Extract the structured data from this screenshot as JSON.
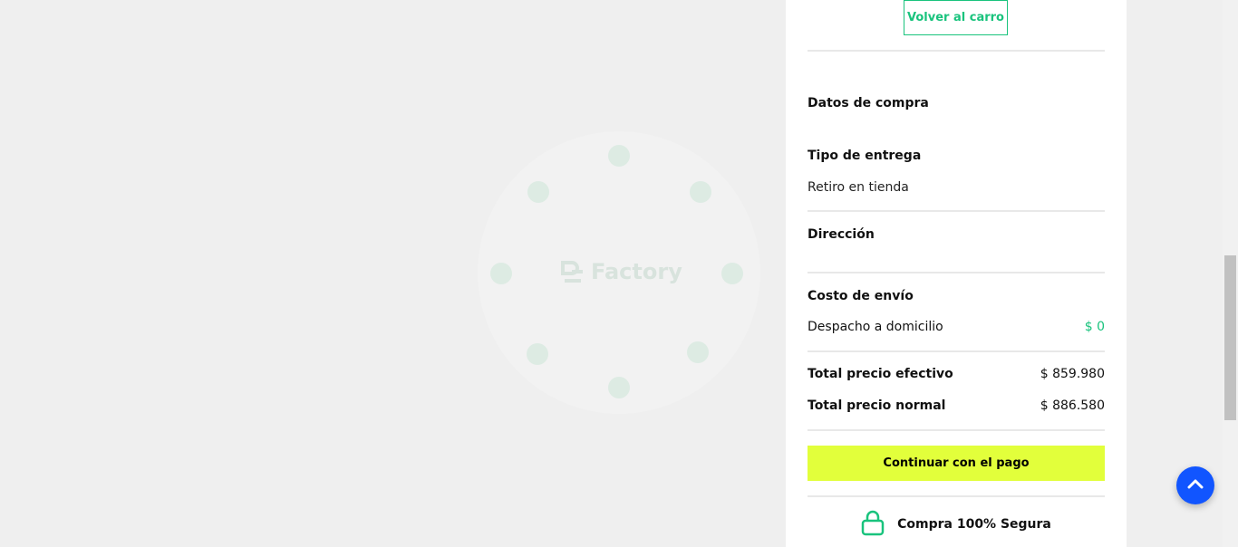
{
  "loader": {
    "logo_text": "Factory",
    "logo_icon": "factory-logo-icon"
  },
  "summary": {
    "back_button": "Volver al carro",
    "section_title": "Datos de compra",
    "delivery": {
      "heading": "Tipo de entrega",
      "value": "Retiro en tienda"
    },
    "address": {
      "heading": "Dirección"
    },
    "shipping": {
      "heading": "Costo de envío",
      "label": "Despacho a domicilio",
      "value": "$ 0"
    },
    "totals": {
      "cash_label": "Total precio efectivo",
      "cash_value": "$ 859.980",
      "normal_label": "Total precio normal",
      "normal_value": "$ 886.580"
    },
    "pay_button": "Continuar con el pago",
    "secure_text": "Compra 100% Segura",
    "secure_icon": "lock-icon"
  },
  "colors": {
    "accent_green": "#19c37d",
    "pay_button_bg": "#e2ff3b",
    "fab_blue": "#1155ff",
    "page_bg": "#efefef"
  },
  "scroll_top_button": {
    "icon": "chevron-up-icon"
  }
}
